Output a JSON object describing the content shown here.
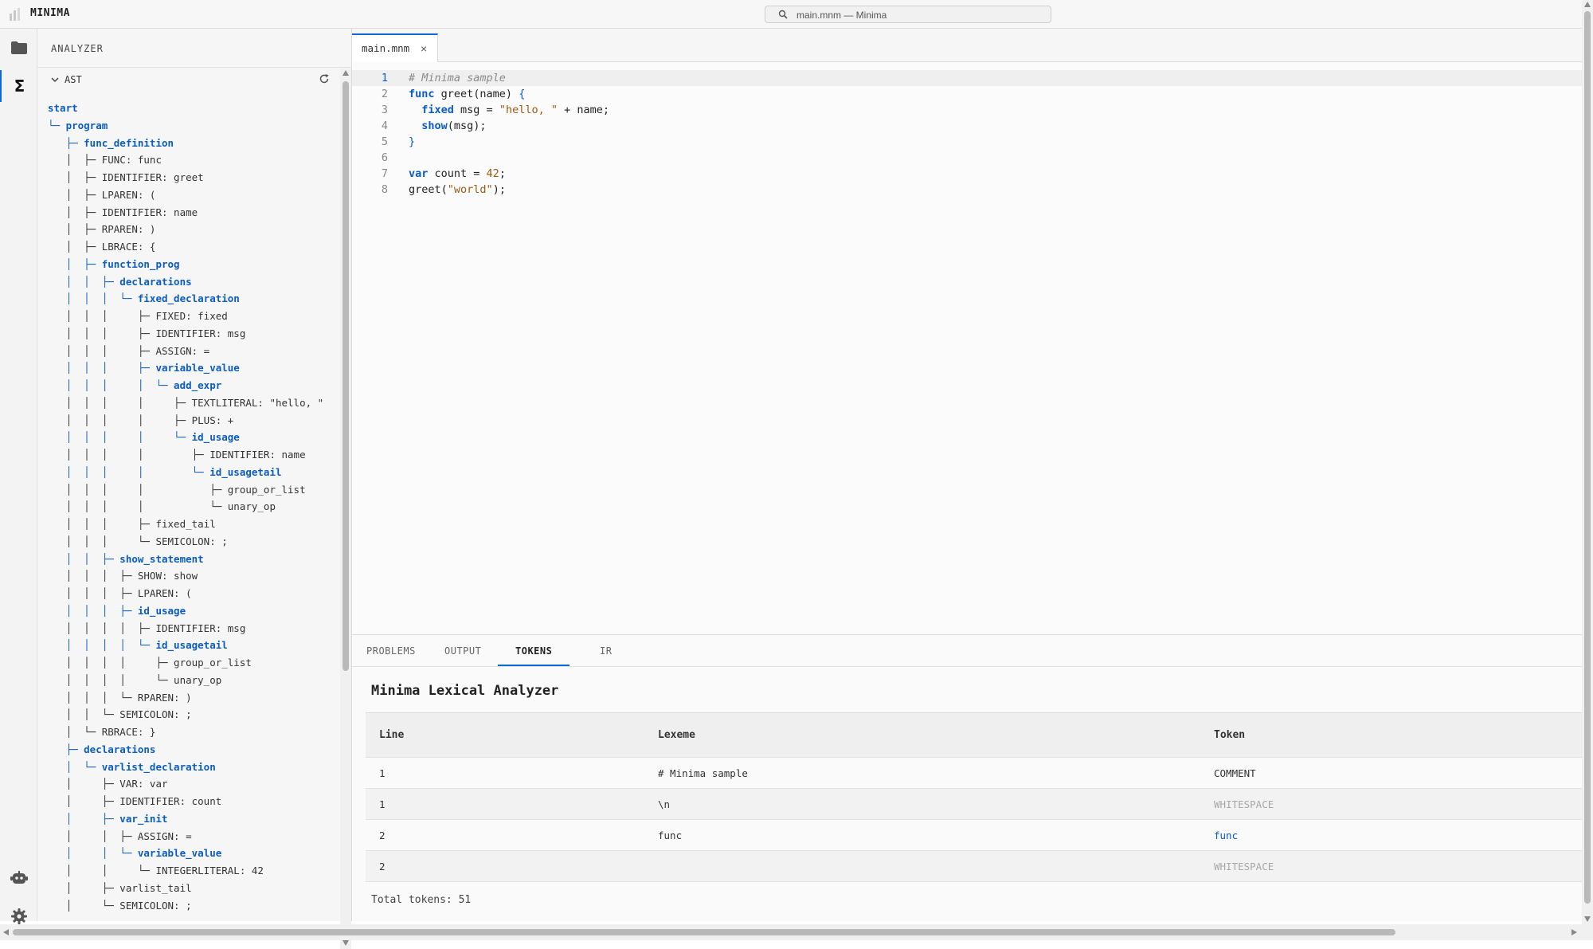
{
  "app": {
    "name": "MINIMA"
  },
  "search": {
    "text": "main.mnm — Minima"
  },
  "activity": {
    "items": [
      {
        "icon": "folder-icon",
        "active": false
      },
      {
        "icon": "sigma-icon",
        "active": true,
        "glyph": "Σ"
      }
    ],
    "bottom": [
      {
        "icon": "robot-icon"
      },
      {
        "icon": "gear-icon"
      }
    ]
  },
  "sidebar": {
    "title": "ANALYZER",
    "section": {
      "label": "AST",
      "expanded": true
    },
    "tree": [
      {
        "text": "start",
        "node": true
      },
      {
        "text": "└─ program",
        "node": true
      },
      {
        "text": "   ├─ func_definition",
        "node": true
      },
      {
        "text": "   │  ├─ FUNC: func",
        "node": false
      },
      {
        "text": "   │  ├─ IDENTIFIER: greet",
        "node": false
      },
      {
        "text": "   │  ├─ LPAREN: (",
        "node": false
      },
      {
        "text": "   │  ├─ IDENTIFIER: name",
        "node": false
      },
      {
        "text": "   │  ├─ RPAREN: )",
        "node": false
      },
      {
        "text": "   │  ├─ LBRACE: {",
        "node": false
      },
      {
        "text": "   │  ├─ function_prog",
        "node": true
      },
      {
        "text": "   │  │  ├─ declarations",
        "node": true
      },
      {
        "text": "   │  │  │  └─ fixed_declaration",
        "node": true
      },
      {
        "text": "   │  │  │     ├─ FIXED: fixed",
        "node": false
      },
      {
        "text": "   │  │  │     ├─ IDENTIFIER: msg",
        "node": false
      },
      {
        "text": "   │  │  │     ├─ ASSIGN: =",
        "node": false
      },
      {
        "text": "   │  │  │     ├─ variable_value",
        "node": true
      },
      {
        "text": "   │  │  │     │  └─ add_expr",
        "node": true
      },
      {
        "text": "   │  │  │     │     ├─ TEXTLITERAL: \"hello, \"",
        "node": false
      },
      {
        "text": "   │  │  │     │     ├─ PLUS: +",
        "node": false
      },
      {
        "text": "   │  │  │     │     └─ id_usage",
        "node": true
      },
      {
        "text": "   │  │  │     │        ├─ IDENTIFIER: name",
        "node": false
      },
      {
        "text": "   │  │  │     │        └─ id_usagetail",
        "node": true
      },
      {
        "text": "   │  │  │     │           ├─ group_or_list",
        "node": false
      },
      {
        "text": "   │  │  │     │           └─ unary_op",
        "node": false
      },
      {
        "text": "   │  │  │     ├─ fixed_tail",
        "node": false
      },
      {
        "text": "   │  │  │     └─ SEMICOLON: ;",
        "node": false
      },
      {
        "text": "   │  │  ├─ show_statement",
        "node": true
      },
      {
        "text": "   │  │  │  ├─ SHOW: show",
        "node": false
      },
      {
        "text": "   │  │  │  ├─ LPAREN: (",
        "node": false
      },
      {
        "text": "   │  │  │  ├─ id_usage",
        "node": true
      },
      {
        "text": "   │  │  │  │  ├─ IDENTIFIER: msg",
        "node": false
      },
      {
        "text": "   │  │  │  │  └─ id_usagetail",
        "node": true
      },
      {
        "text": "   │  │  │  │     ├─ group_or_list",
        "node": false
      },
      {
        "text": "   │  │  │  │     └─ unary_op",
        "node": false
      },
      {
        "text": "   │  │  │  └─ RPAREN: )",
        "node": false
      },
      {
        "text": "   │  │  └─ SEMICOLON: ;",
        "node": false
      },
      {
        "text": "   │  └─ RBRACE: }",
        "node": false
      },
      {
        "text": "   ├─ declarations",
        "node": true
      },
      {
        "text": "   │  └─ varlist_declaration",
        "node": true
      },
      {
        "text": "   │     ├─ VAR: var",
        "node": false
      },
      {
        "text": "   │     ├─ IDENTIFIER: count",
        "node": false
      },
      {
        "text": "   │     ├─ var_init",
        "node": true
      },
      {
        "text": "   │     │  ├─ ASSIGN: =",
        "node": false
      },
      {
        "text": "   │     │  └─ variable_value",
        "node": true
      },
      {
        "text": "   │     │     └─ INTEGERLITERAL: 42",
        "node": false
      },
      {
        "text": "   │     ├─ varlist_tail",
        "node": false
      },
      {
        "text": "   │     └─ SEMICOLON: ;",
        "node": false
      }
    ]
  },
  "editor": {
    "tab": {
      "label": "main.mnm",
      "close": "×"
    },
    "current_line": 1,
    "lines": [
      {
        "n": "1",
        "parts": [
          {
            "t": "# Minima sample",
            "c": "cm"
          }
        ]
      },
      {
        "n": "2",
        "parts": [
          {
            "t": "func",
            "c": "kw"
          },
          {
            "t": " greet(name) "
          },
          {
            "t": "{",
            "c": "pn"
          }
        ]
      },
      {
        "n": "3",
        "parts": [
          {
            "t": "  "
          },
          {
            "t": "fixed",
            "c": "kw"
          },
          {
            "t": " msg = "
          },
          {
            "t": "\"hello, \"",
            "c": "st"
          },
          {
            "t": " + name;"
          }
        ]
      },
      {
        "n": "4",
        "parts": [
          {
            "t": "  "
          },
          {
            "t": "show",
            "c": "kw"
          },
          {
            "t": "(msg);"
          }
        ]
      },
      {
        "n": "5",
        "parts": [
          {
            "t": "}",
            "c": "pn"
          }
        ]
      },
      {
        "n": "6",
        "parts": [
          {
            "t": ""
          }
        ]
      },
      {
        "n": "7",
        "parts": [
          {
            "t": "var",
            "c": "kw"
          },
          {
            "t": " count = "
          },
          {
            "t": "42",
            "c": "nm"
          },
          {
            "t": ";"
          }
        ]
      },
      {
        "n": "8",
        "parts": [
          {
            "t": "greet("
          },
          {
            "t": "\"world\"",
            "c": "st"
          },
          {
            "t": ");"
          }
        ]
      }
    ]
  },
  "panel": {
    "tabs": [
      {
        "label": "PROBLEMS",
        "active": false
      },
      {
        "label": "OUTPUT",
        "active": false
      },
      {
        "label": "TOKENS",
        "active": true
      },
      {
        "label": "IR",
        "active": false
      }
    ],
    "title": "Minima Lexical Analyzer",
    "columns": [
      "Line",
      "Lexeme",
      "Token"
    ],
    "rows": [
      {
        "line": "1",
        "lexeme": "# Minima sample",
        "token": "COMMENT",
        "style": "normal"
      },
      {
        "line": "1",
        "lexeme": "\\n",
        "token": "WHITESPACE",
        "style": "ws"
      },
      {
        "line": "2",
        "lexeme": "func",
        "token": "func",
        "style": "kw"
      },
      {
        "line": "2",
        "lexeme": "",
        "token": "WHITESPACE",
        "style": "ws"
      }
    ],
    "total": "Total tokens: 51"
  },
  "colors": {
    "accent": "#0b6ad6",
    "keyword": "#0b5cbf",
    "literal": "#9a5a14",
    "comment": "#8a8a8a"
  }
}
